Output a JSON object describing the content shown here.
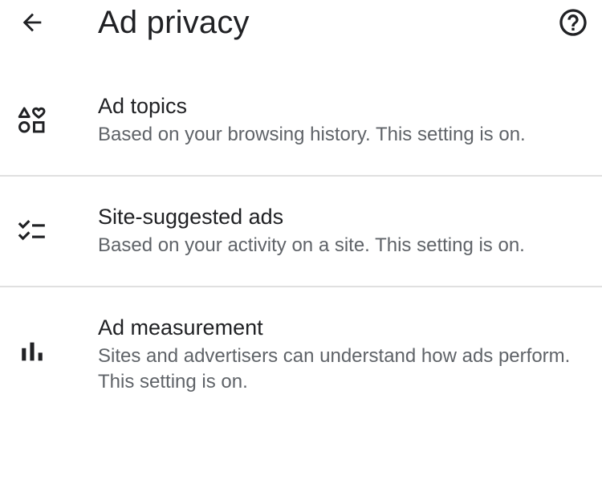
{
  "app_bar": {
    "title": "Ad privacy",
    "back_icon": "arrow-back-icon",
    "help_icon": "help-circle-icon"
  },
  "settings": [
    {
      "icon": "interests-icon",
      "title": "Ad topics",
      "subtitle": "Based on your browsing history. This setting is on."
    },
    {
      "icon": "checklist-icon",
      "title": "Site-suggested ads",
      "subtitle": "Based on your activity on a site. This setting is on."
    },
    {
      "icon": "bar-chart-icon",
      "title": "Ad measurement",
      "subtitle": "Sites and advertisers can understand how ads perform. This setting is on."
    }
  ],
  "colors": {
    "text_primary": "#202124",
    "text_secondary": "#5f6368",
    "divider": "#e0e0e0",
    "background": "#ffffff"
  }
}
